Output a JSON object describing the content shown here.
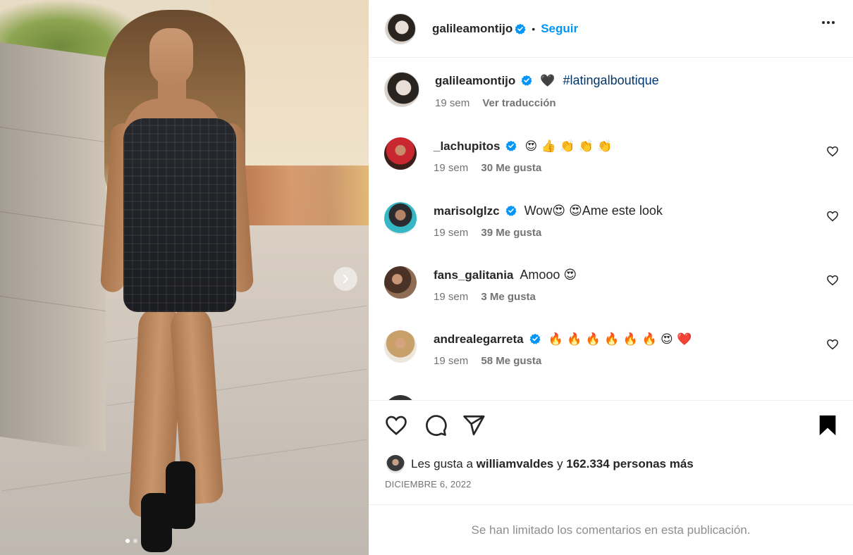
{
  "post": {
    "author": "galileamontijo",
    "follow_label": "Seguir",
    "separator": "•",
    "media": {
      "image_description": "photo",
      "slide_count": 2,
      "active_slide": 1
    }
  },
  "caption": {
    "username": "galileamontijo",
    "heart": "🖤",
    "hashtag": "#latingalboutique",
    "time": "19 sem",
    "translate_label": "Ver traducción"
  },
  "comments": [
    {
      "username": "_lachupitos",
      "verified": true,
      "text": "😍 👍 👏 👏 👏",
      "time": "19 sem",
      "likes": "30 Me gusta"
    },
    {
      "username": "marisolglzc",
      "verified": true,
      "text": "Wow😍 😍Ame este look",
      "time": "19 sem",
      "likes": "39 Me gusta"
    },
    {
      "username": "fans_galitania",
      "verified": false,
      "text": "Amooo 😍",
      "time": "19 sem",
      "likes": "3 Me gusta"
    },
    {
      "username": "andrealegarreta",
      "verified": true,
      "text": "🔥 🔥 🔥 🔥 🔥 🔥 😍 ❤️",
      "time": "19 sem",
      "likes": "58 Me gusta"
    }
  ],
  "likes_summary": {
    "prefix": "Les gusta a",
    "user": "williamvaldes",
    "conjunction": "y",
    "count": "162.334 personas más"
  },
  "date": "DICIEMBRE 6, 2022",
  "comments_limited": "Se han limitado los comentarios en esta publicación.",
  "colors": {
    "accent": "#0095f6",
    "verified": "#0095f6",
    "text": "#262626",
    "muted": "#737373"
  },
  "icons": [
    "more-icon",
    "heart-icon",
    "comment-icon",
    "share-icon",
    "bookmark-icon",
    "verified-icon",
    "chevron-right-icon"
  ]
}
